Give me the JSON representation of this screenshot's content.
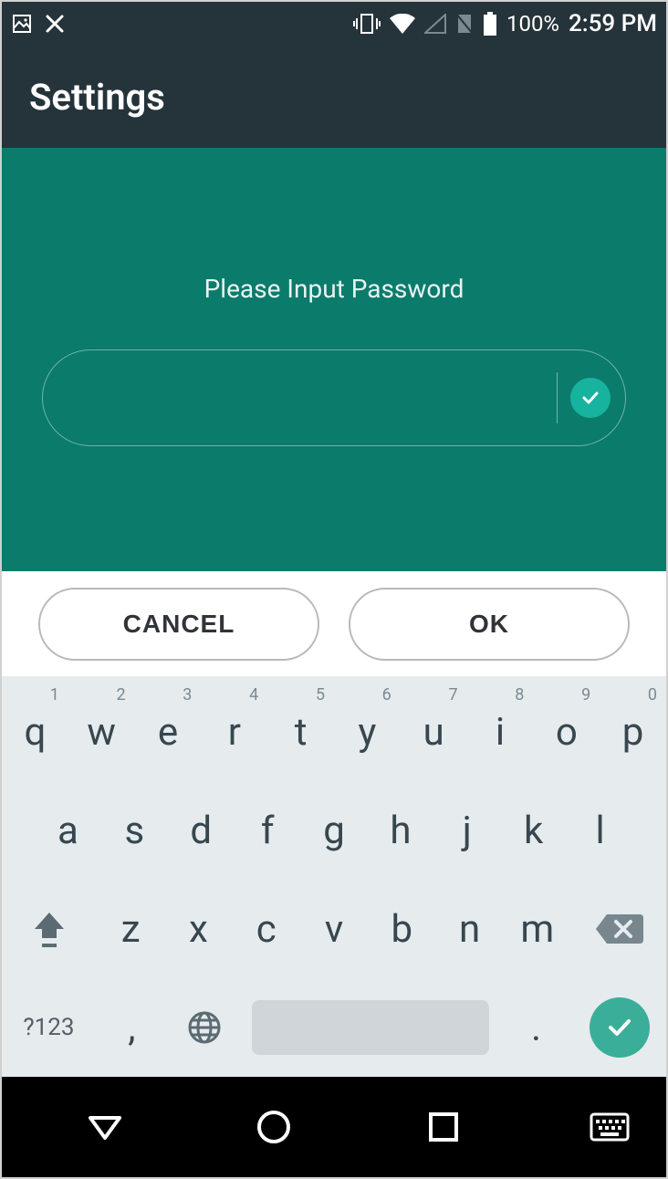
{
  "statusbar": {
    "battery_pct": "100%",
    "time": "2:59 PM"
  },
  "appbar": {
    "title": "Settings"
  },
  "content": {
    "prompt": "Please Input Password",
    "input_value": ""
  },
  "buttons": {
    "cancel": "CANCEL",
    "ok": "OK"
  },
  "keyboard": {
    "row1": [
      {
        "label": "q",
        "hint": "1"
      },
      {
        "label": "w",
        "hint": "2"
      },
      {
        "label": "e",
        "hint": "3"
      },
      {
        "label": "r",
        "hint": "4"
      },
      {
        "label": "t",
        "hint": "5"
      },
      {
        "label": "y",
        "hint": "6"
      },
      {
        "label": "u",
        "hint": "7"
      },
      {
        "label": "i",
        "hint": "8"
      },
      {
        "label": "o",
        "hint": "9"
      },
      {
        "label": "p",
        "hint": "0"
      }
    ],
    "row2": [
      {
        "label": "a"
      },
      {
        "label": "s"
      },
      {
        "label": "d"
      },
      {
        "label": "f"
      },
      {
        "label": "g"
      },
      {
        "label": "h"
      },
      {
        "label": "j"
      },
      {
        "label": "k"
      },
      {
        "label": "l"
      }
    ],
    "row3": [
      {
        "label": "z"
      },
      {
        "label": "x"
      },
      {
        "label": "c"
      },
      {
        "label": "v"
      },
      {
        "label": "b"
      },
      {
        "label": "n"
      },
      {
        "label": "m"
      }
    ],
    "symbols_label": "?123",
    "comma": ",",
    "period": "."
  }
}
